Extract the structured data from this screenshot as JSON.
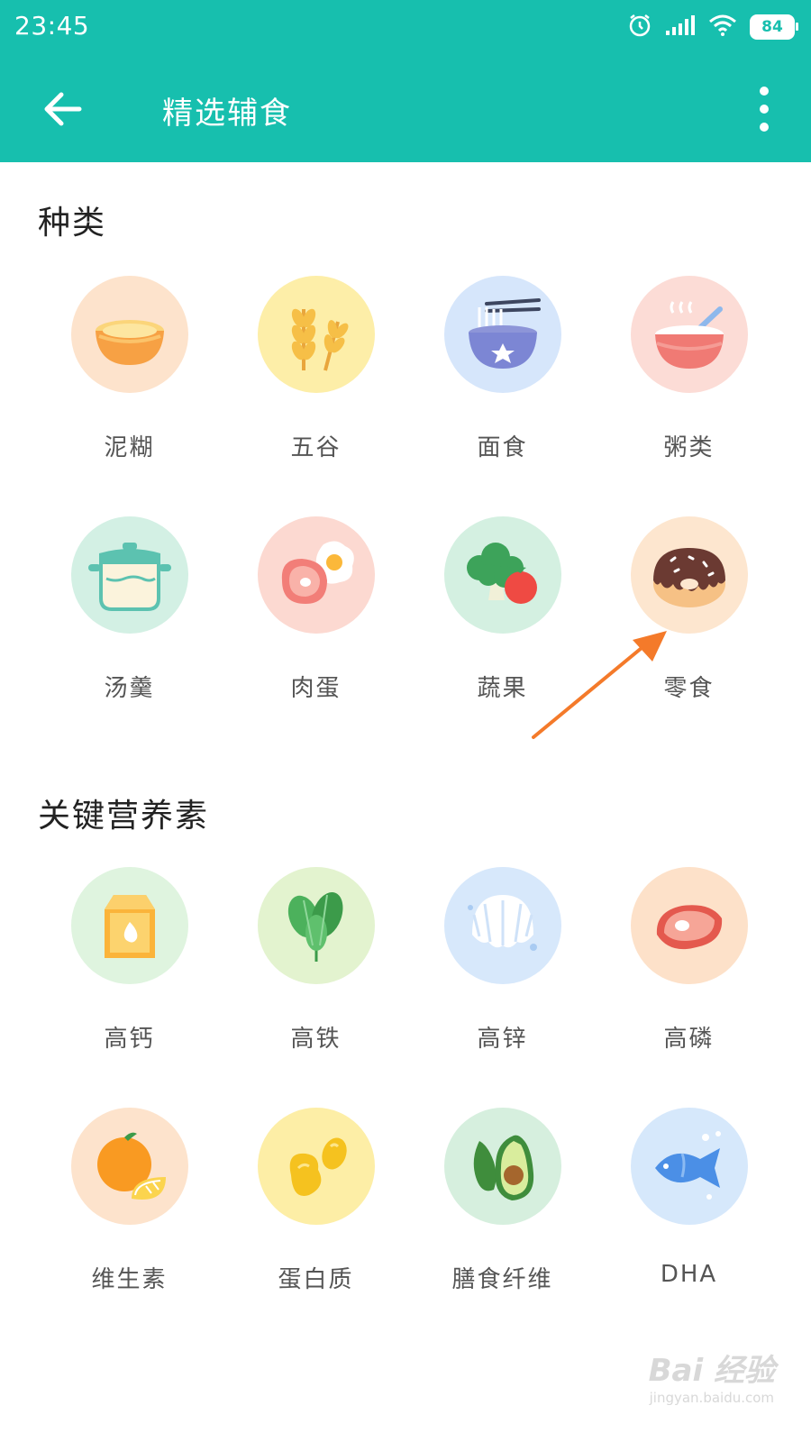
{
  "status_bar": {
    "time": "23:45",
    "battery": "84",
    "icons": [
      "alarm-icon",
      "signal-icon",
      "wifi-icon",
      "battery-icon"
    ]
  },
  "app_bar": {
    "title": "精选辅食",
    "back_icon": "arrow-left-icon",
    "more_icon": "more-vertical-icon"
  },
  "sections": [
    {
      "title": "种类",
      "items": [
        {
          "label": "泥糊",
          "icon": "puree-bowl-icon",
          "bg": "#fde3cc"
        },
        {
          "label": "五谷",
          "icon": "wheat-icon",
          "bg": "#fdeea8"
        },
        {
          "label": "面食",
          "icon": "noodle-bowl-icon",
          "bg": "#d6e6fb"
        },
        {
          "label": "粥类",
          "icon": "porridge-bowl-icon",
          "bg": "#fcdcd6"
        },
        {
          "label": "汤羹",
          "icon": "soup-pot-icon",
          "bg": "#d3f0e4"
        },
        {
          "label": "肉蛋",
          "icon": "meat-egg-icon",
          "bg": "#fcd9d1"
        },
        {
          "label": "蔬果",
          "icon": "broccoli-tomato-icon",
          "bg": "#d4f0e1"
        },
        {
          "label": "零食",
          "icon": "donut-icon",
          "bg": "#fde6cf"
        }
      ]
    },
    {
      "title": "关键营养素",
      "items": [
        {
          "label": "高钙",
          "icon": "milk-carton-icon",
          "bg": "#dff4df"
        },
        {
          "label": "高铁",
          "icon": "spinach-icon",
          "bg": "#e3f3cf"
        },
        {
          "label": "高锌",
          "icon": "shell-icon",
          "bg": "#d7e8fb"
        },
        {
          "label": "高磷",
          "icon": "steak-icon",
          "bg": "#fde1c9"
        },
        {
          "label": "维生素",
          "icon": "orange-icon",
          "bg": "#fde3cc"
        },
        {
          "label": "蛋白质",
          "icon": "beans-icon",
          "bg": "#fdeea6"
        },
        {
          "label": "膳食纤维",
          "icon": "avocado-icon",
          "bg": "#d6efde"
        },
        {
          "label": "DHA",
          "icon": "fish-icon",
          "bg": "#d6e8fb"
        }
      ]
    }
  ],
  "watermark": {
    "logo": "Bai 经验",
    "url": "jingyan.baidu.com"
  },
  "colors": {
    "primary": "#17bfae",
    "arrow": "#f47a2a"
  }
}
